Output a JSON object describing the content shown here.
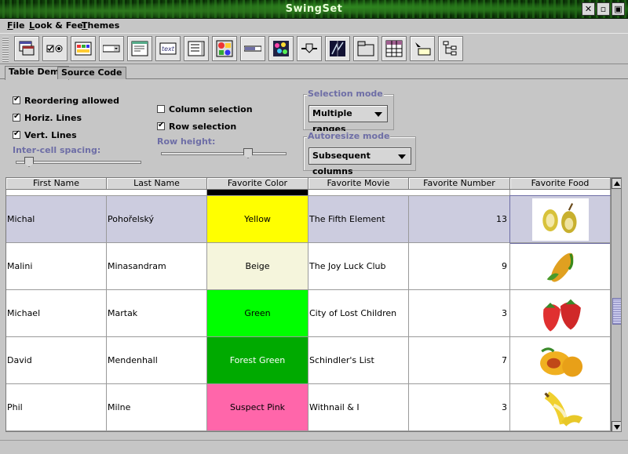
{
  "window": {
    "title": "SwingSet"
  },
  "menu": [
    "File",
    "Look & Feel",
    "Themes"
  ],
  "toolbar_icons": [
    "internal-frame-icon",
    "checkbox-radio-icon",
    "color-chooser-icon",
    "combobox-icon",
    "file-chooser-icon",
    "text-editor-icon",
    "list-icon",
    "option-pane-icon",
    "progress-bar-icon",
    "scroll-pane-icon",
    "slider-icon",
    "split-pane-icon",
    "tabbed-pane-icon",
    "table-icon",
    "tooltip-icon",
    "tree-icon"
  ],
  "tabs": [
    {
      "label": "Table Demo",
      "active": true
    },
    {
      "label": "Source Code",
      "active": false
    }
  ],
  "options": {
    "reordering": {
      "label": "Reordering allowed",
      "checked": true
    },
    "horiz_lines": {
      "label": "Horiz. Lines",
      "checked": true
    },
    "vert_lines": {
      "label": "Vert. Lines",
      "checked": true
    },
    "column_selection": {
      "label": "Column selection",
      "checked": false
    },
    "row_selection": {
      "label": "Row selection",
      "checked": true
    },
    "intercell_label": "Inter-cell spacing:",
    "row_height_label": "Row height:",
    "intercell_value": 0.1,
    "row_height_value": 0.7
  },
  "selection_mode": {
    "title": "Selection mode",
    "value": "Multiple ranges"
  },
  "autoresize_mode": {
    "title": "Autoresize mode",
    "value": "Subsequent columns"
  },
  "table": {
    "columns": [
      "First Name",
      "Last Name",
      "Favorite Color",
      "Favorite Movie",
      "Favorite Number",
      "Favorite Food"
    ],
    "rows": [
      {
        "first": "Michal",
        "last": "Pohořelský",
        "color": "Yellow",
        "color_hex": "#ffff00",
        "color_text": "#000000",
        "movie": "The Fifth Element",
        "number": "13",
        "food": "pear-image",
        "selected": true
      },
      {
        "first": "Malini",
        "last": "Minasandram",
        "color": "Beige",
        "color_hex": "#f5f5dc",
        "color_text": "#000000",
        "movie": "The Joy Luck Club",
        "number": "9",
        "food": "corn-image",
        "selected": false
      },
      {
        "first": "Michael",
        "last": "Martak",
        "color": "Green",
        "color_hex": "#00ff00",
        "color_text": "#000000",
        "movie": "City of Lost Children",
        "number": "3",
        "food": "strawberry-image",
        "selected": false
      },
      {
        "first": "David",
        "last": "Mendenhall",
        "color": "Forest Green",
        "color_hex": "#00aa00",
        "color_text": "#ffffff",
        "movie": "Schindler's List",
        "number": "7",
        "food": "peach-image",
        "selected": false
      },
      {
        "first": "Phil",
        "last": "Milne",
        "color": "Suspect Pink",
        "color_hex": "#ff66aa",
        "color_text": "#000000",
        "movie": "Withnail & I",
        "number": "3",
        "food": "banana-image",
        "selected": false
      }
    ]
  },
  "colors": {
    "selection": "#ccccdf",
    "accent_label": "#6e6ea6"
  }
}
